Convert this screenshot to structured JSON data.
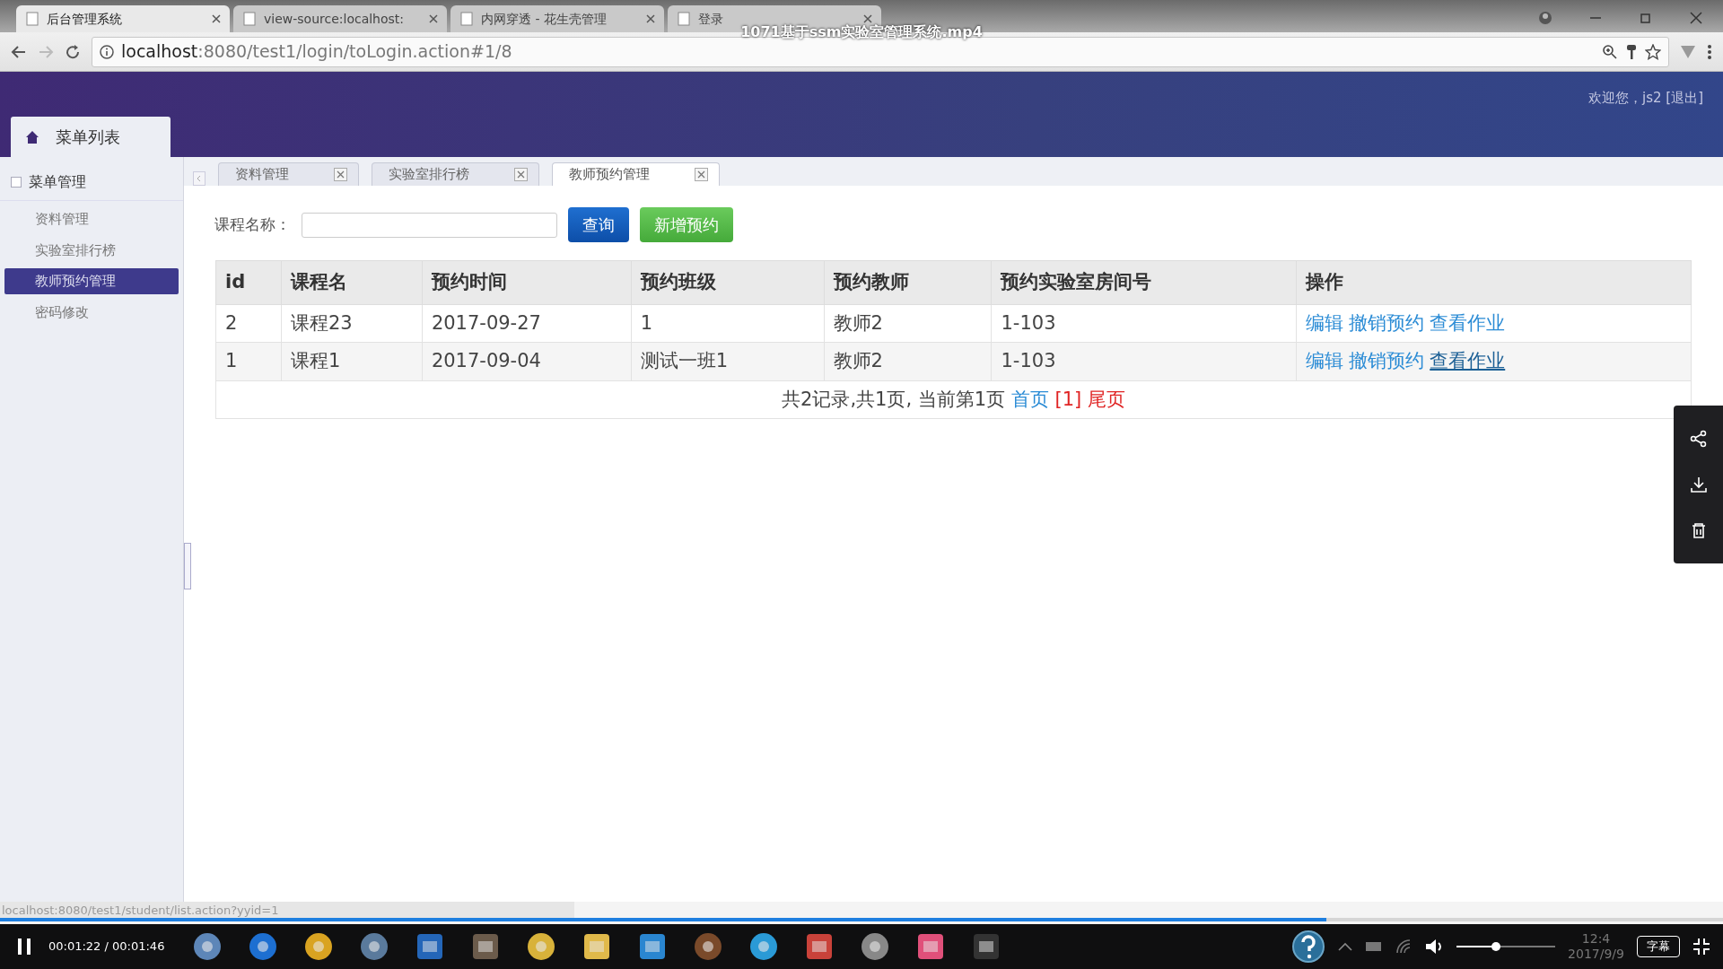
{
  "browser": {
    "tabs": [
      {
        "label": "后台管理系统",
        "selected": true
      },
      {
        "label": "view-source:localhost:",
        "selected": false
      },
      {
        "label": "内网穿透 - 花生壳管理",
        "selected": false
      },
      {
        "label": "登录",
        "selected": false
      }
    ],
    "url_host": "localhost",
    "url_rest": ":8080/test1/login/toLogin.action#1/8",
    "status_url": "localhost:8080/test1/student/list.action?yyid=1"
  },
  "video": {
    "title": "1071基于ssm实验室管理系统.mp4",
    "time": "00:01:22 / 00:01:46",
    "progress": {
      "level": 0.77
    },
    "volume": {
      "level": 0.4
    },
    "subtitle_button": "字幕"
  },
  "header": {
    "welcome": "欢迎您，js2 [退出]"
  },
  "sidebar": {
    "title": "菜单列表",
    "group": "菜单管理",
    "items": [
      {
        "label": "资料管理",
        "selected": false
      },
      {
        "label": "实验室排行榜",
        "selected": false
      },
      {
        "label": "教师预约管理",
        "selected": true
      },
      {
        "label": "密码修改",
        "selected": false
      }
    ]
  },
  "content_tabs": [
    {
      "label": "资料管理",
      "selected": false
    },
    {
      "label": "实验室排行榜",
      "selected": false
    },
    {
      "label": "教师预约管理",
      "selected": true
    }
  ],
  "search": {
    "label": "课程名称："
  },
  "buttons": [
    {
      "label": "查询",
      "kind": "primary"
    },
    {
      "label": "新增预约",
      "kind": "success"
    }
  ],
  "table": {
    "columns": [
      "id",
      "课程名",
      "预约时间",
      "预约班级",
      "预约教师",
      "预约实验室房间号",
      "操作"
    ],
    "rows": [
      {
        "cells": [
          "2",
          "课程23",
          "2017-09-27",
          "1",
          "教师2",
          "1-103"
        ],
        "actions": [
          {
            "label": "编辑",
            "hovered": false
          },
          {
            "label": "撤销预约",
            "hovered": false
          },
          {
            "label": "查看作业",
            "hovered": false
          }
        ]
      },
      {
        "cells": [
          "1",
          "课程1",
          "2017-09-04",
          "测试一班1",
          "教师2",
          "1-103"
        ],
        "actions": [
          {
            "label": "编辑",
            "hovered": false
          },
          {
            "label": "撤销预约",
            "hovered": false
          },
          {
            "label": "查看作业",
            "hovered": true
          }
        ]
      }
    ]
  },
  "pagination": {
    "summary": "共2记录,共1页, 当前第1页",
    "first": "首页",
    "current": "[1]",
    "last": "尾页"
  },
  "clock": {
    "time": "12:4",
    "date": "2017/9/9"
  }
}
